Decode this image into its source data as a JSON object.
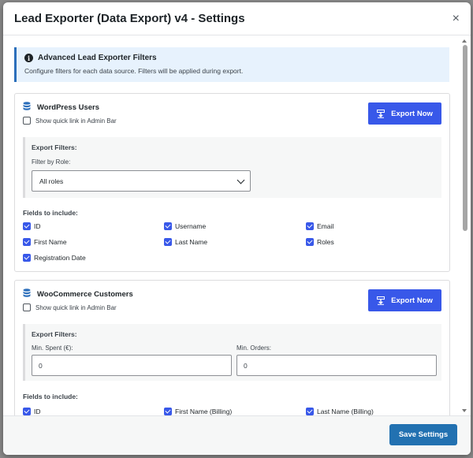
{
  "modal": {
    "title": "Lead Exporter (Data Export) v4 - Settings",
    "close_label": "×",
    "save_label": "Save Settings"
  },
  "info": {
    "icon": "info-icon",
    "title": "Advanced Lead Exporter Filters",
    "description": "Configure filters for each data source. Filters will be applied during export."
  },
  "sources": [
    {
      "title": "WordPress Users",
      "icon": "database-icon",
      "quick_link_label": "Show quick link in Admin Bar",
      "quick_link_checked": false,
      "export_label": "Export Now",
      "filters_title": "Export Filters:",
      "role_label": "Filter by Role:",
      "role_value": "All roles",
      "fields_title": "Fields to include:",
      "fields": [
        {
          "label": "ID",
          "checked": true
        },
        {
          "label": "Username",
          "checked": true
        },
        {
          "label": "Email",
          "checked": true
        },
        {
          "label": "First Name",
          "checked": true
        },
        {
          "label": "Last Name",
          "checked": true
        },
        {
          "label": "Roles",
          "checked": true
        },
        {
          "label": "Registration Date",
          "checked": true
        }
      ]
    },
    {
      "title": "WooCommerce Customers",
      "icon": "database-icon",
      "quick_link_label": "Show quick link in Admin Bar",
      "quick_link_checked": false,
      "export_label": "Export Now",
      "filters_title": "Export Filters:",
      "min_spent_label": "Min. Spent (€):",
      "min_spent_value": "0",
      "min_orders_label": "Min. Orders:",
      "min_orders_value": "0",
      "fields_title": "Fields to include:",
      "fields": [
        {
          "label": "ID",
          "checked": true
        },
        {
          "label": "First Name (Billing)",
          "checked": true
        },
        {
          "label": "Last Name (Billing)",
          "checked": true
        }
      ]
    }
  ],
  "colors": {
    "primary": "#3858e9",
    "save": "#2271b1",
    "info_bg": "#e7f2fd"
  }
}
